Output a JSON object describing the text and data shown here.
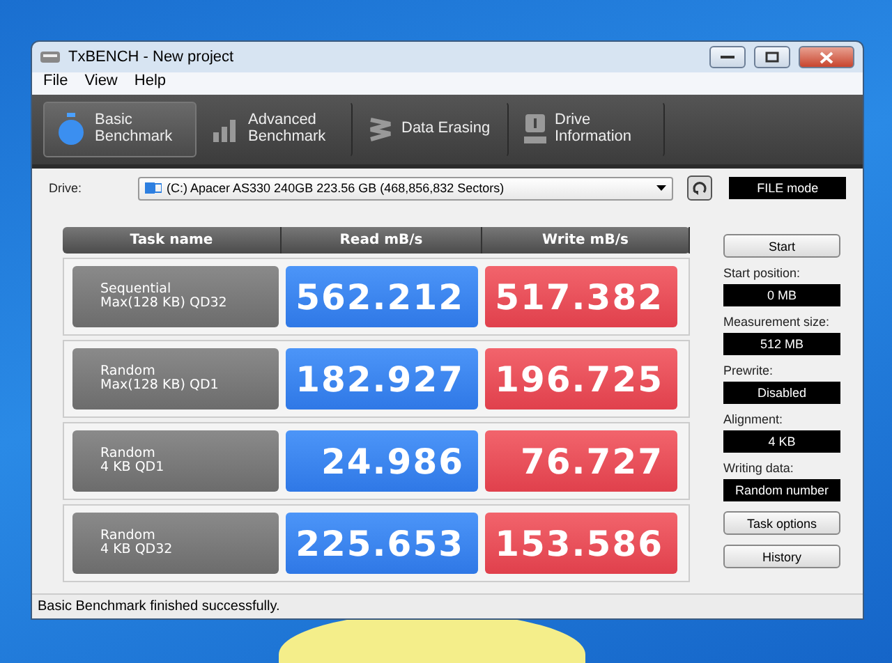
{
  "window": {
    "title": "TxBENCH - New project"
  },
  "menu": [
    "File",
    "View",
    "Help"
  ],
  "tabs": [
    {
      "label": "Basic\nBenchmark",
      "kind": "stopwatch",
      "selected": true
    },
    {
      "label": "Advanced\nBenchmark",
      "kind": "bars",
      "selected": false
    },
    {
      "label": "Data Erasing",
      "kind": "eraser",
      "selected": false
    },
    {
      "label": "Drive\nInformation",
      "kind": "drive",
      "selected": false
    }
  ],
  "drive": {
    "label": "Drive:",
    "value": "(C:) Apacer AS330 240GB  223.56 GB (468,856,832 Sectors)",
    "mode": "FILE mode"
  },
  "table": {
    "columns": [
      "Task name",
      "Read mB/s",
      "Write mB/s"
    ],
    "rows": [
      {
        "task": "Sequential\nMax(128 KB) QD32",
        "read": "562.212",
        "write": "517.382"
      },
      {
        "task": "Random\nMax(128 KB) QD1",
        "read": "182.927",
        "write": "196.725"
      },
      {
        "task": "Random\n4 KB QD1",
        "read": "24.986",
        "write": "76.727"
      },
      {
        "task": "Random\n4 KB QD32",
        "read": "225.653",
        "write": "153.586"
      }
    ]
  },
  "start_button": "Start",
  "settings": [
    {
      "label": "Start position:",
      "value": "0 MB"
    },
    {
      "label": "Measurement size:",
      "value": "512 MB"
    },
    {
      "label": "Prewrite:",
      "value": "Disabled"
    },
    {
      "label": "Alignment:",
      "value": "4 KB"
    },
    {
      "label": "Writing data:",
      "value": "Random number"
    }
  ],
  "buttons": [
    "Task options",
    "History"
  ],
  "status_bar": "Basic Benchmark finished successfully."
}
